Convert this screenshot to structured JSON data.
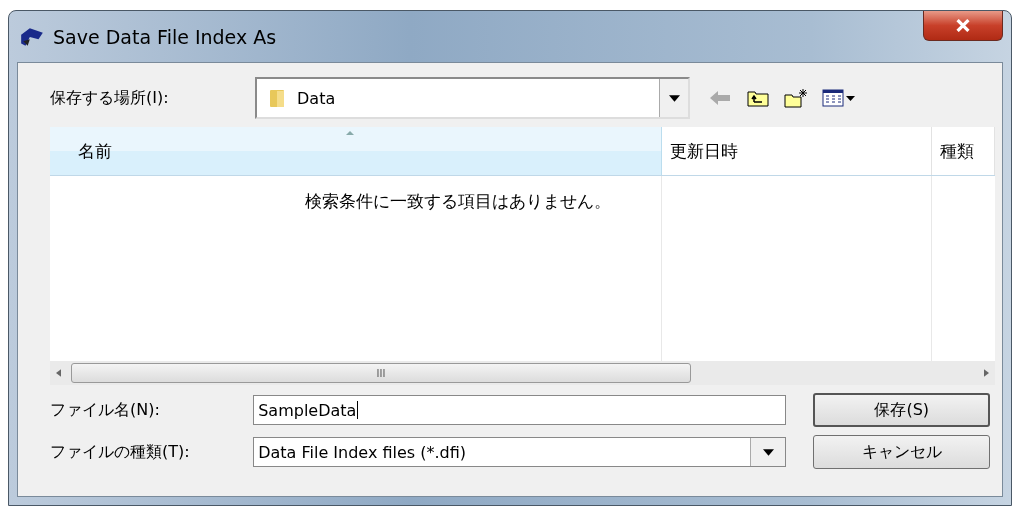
{
  "window": {
    "title": "Save Data File Index As"
  },
  "location": {
    "label": "保存する場所(I):",
    "value": "Data"
  },
  "file_list": {
    "columns": [
      {
        "label": "名前",
        "sorted": true
      },
      {
        "label": "更新日時",
        "sorted": false
      },
      {
        "label": "種類",
        "sorted": false
      }
    ],
    "empty_message": "検索条件に一致する項目はありません。",
    "scroll_label": "III"
  },
  "file_name": {
    "label": "ファイル名(N):",
    "value": "SampleData"
  },
  "file_type": {
    "label": "ファイルの種類(T):",
    "value": "Data File Index files (*.dfi)"
  },
  "buttons": [
    {
      "label": "保存(S)",
      "default": true
    },
    {
      "label": "キャンセル",
      "default": false
    }
  ]
}
